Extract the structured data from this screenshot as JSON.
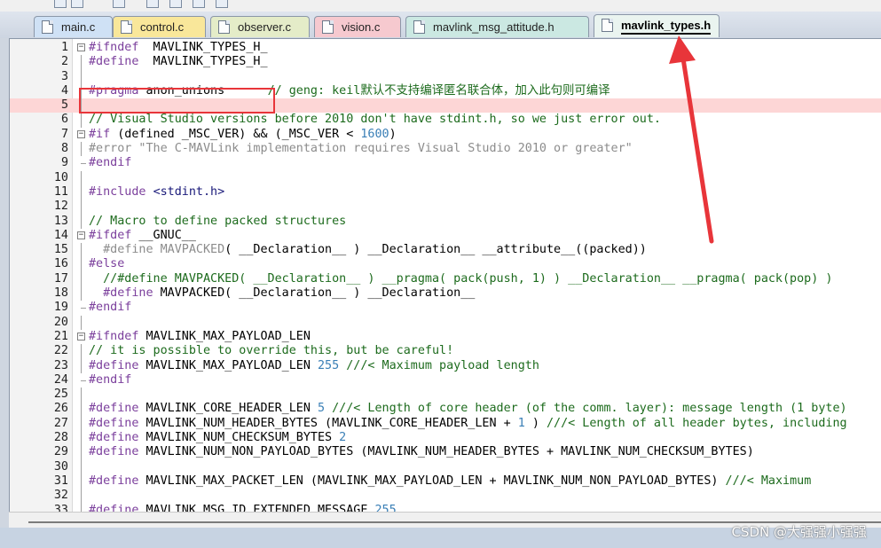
{
  "tabs": [
    {
      "label": "main.c",
      "bg": "#cfe1f5"
    },
    {
      "label": "control.c",
      "bg": "#f9e79a"
    },
    {
      "label": "observer.c",
      "bg": "#e4ecc8"
    },
    {
      "label": "vision.c",
      "bg": "#f6c9cf"
    },
    {
      "label": "mavlink_msg_attitude.h",
      "bg": "#cbe8e2"
    },
    {
      "label": "mavlink_types.h",
      "bg": "#eaf4f0",
      "active": true
    }
  ],
  "code_lines": [
    {
      "n": "1",
      "fold": "box",
      "t": [
        [
          "pp",
          "#ifndef"
        ],
        [
          "",
          "  MAVLINK_TYPES_H_"
        ]
      ]
    },
    {
      "n": "2",
      "fold": "bar",
      "t": [
        [
          "pp",
          "#define"
        ],
        [
          "",
          "  MAVLINK_TYPES_H_"
        ]
      ]
    },
    {
      "n": "3",
      "fold": "bar",
      "t": []
    },
    {
      "n": "4",
      "fold": "bar",
      "t": [
        [
          "pp",
          "#pragma"
        ],
        [
          "",
          " anon_unions"
        ],
        [
          "",
          "      "
        ],
        [
          "cm",
          "// geng: keil默认不支持编译匿名联合体，加入此句则可编译"
        ]
      ]
    },
    {
      "n": "5",
      "fold": "bar",
      "hl": true,
      "t": []
    },
    {
      "n": "6",
      "fold": "bar",
      "t": [
        [
          "cm",
          "// Visual Studio versions before 2010 don't have stdint.h, so we just error out."
        ]
      ]
    },
    {
      "n": "7",
      "fold": "box",
      "t": [
        [
          "pp",
          "#if"
        ],
        [
          "",
          " (defined _MSC_VER) && (_MSC_VER < "
        ],
        [
          "num",
          "1600"
        ],
        [
          "",
          ")"
        ]
      ]
    },
    {
      "n": "8",
      "fold": "bar",
      "t": [
        [
          "cmg",
          "#error \"The C-MAVLink implementation requires Visual Studio 2010 or greater\""
        ]
      ]
    },
    {
      "n": "9",
      "fold": "end",
      "t": [
        [
          "pp",
          "#endif"
        ]
      ]
    },
    {
      "n": "10",
      "fold": "bar",
      "t": []
    },
    {
      "n": "11",
      "fold": "bar",
      "t": [
        [
          "pp",
          "#include"
        ],
        [
          "",
          " "
        ],
        [
          "inc",
          "<stdint.h>"
        ]
      ]
    },
    {
      "n": "12",
      "fold": "bar",
      "t": []
    },
    {
      "n": "13",
      "fold": "bar",
      "t": [
        [
          "cm",
          "// Macro to define packed structures"
        ]
      ]
    },
    {
      "n": "14",
      "fold": "box",
      "t": [
        [
          "pp",
          "#ifdef"
        ],
        [
          "",
          " __GNUC__"
        ]
      ]
    },
    {
      "n": "15",
      "fold": "bar",
      "t": [
        [
          "cmg",
          "  #define MAVPACKED"
        ],
        [
          "",
          "( __Declaration__ ) __Declaration__ __attribute__((packed))"
        ]
      ]
    },
    {
      "n": "16",
      "fold": "bar",
      "t": [
        [
          "pp",
          "#else"
        ]
      ]
    },
    {
      "n": "17",
      "fold": "bar",
      "t": [
        [
          "cm",
          "  //#define MAVPACKED( __Declaration__ ) __pragma( pack(push, 1) ) __Declaration__ __pragma( pack(pop) )"
        ]
      ]
    },
    {
      "n": "18",
      "fold": "bar",
      "t": [
        [
          "pp",
          "  #define"
        ],
        [
          "",
          " MAVPACKED( __Declaration__ ) __Declaration__"
        ]
      ]
    },
    {
      "n": "19",
      "fold": "end",
      "t": [
        [
          "pp",
          "#endif"
        ]
      ]
    },
    {
      "n": "20",
      "fold": "bar",
      "t": []
    },
    {
      "n": "21",
      "fold": "box",
      "t": [
        [
          "pp",
          "#ifndef"
        ],
        [
          "",
          " MAVLINK_MAX_PAYLOAD_LEN"
        ]
      ]
    },
    {
      "n": "22",
      "fold": "bar",
      "t": [
        [
          "cm",
          "// it is possible to override this, but be careful!"
        ]
      ]
    },
    {
      "n": "23",
      "fold": "bar",
      "t": [
        [
          "pp",
          "#define"
        ],
        [
          "",
          " MAVLINK_MAX_PAYLOAD_LEN "
        ],
        [
          "num",
          "255"
        ],
        [
          "",
          " "
        ],
        [
          "cm",
          "///< Maximum payload length"
        ]
      ]
    },
    {
      "n": "24",
      "fold": "end",
      "t": [
        [
          "pp",
          "#endif"
        ]
      ]
    },
    {
      "n": "25",
      "fold": "bar",
      "t": []
    },
    {
      "n": "26",
      "fold": "bar",
      "t": [
        [
          "pp",
          "#define"
        ],
        [
          "",
          " MAVLINK_CORE_HEADER_LEN "
        ],
        [
          "num",
          "5"
        ],
        [
          "",
          " "
        ],
        [
          "cm",
          "///< Length of core header (of the comm. layer): message length (1 byte)"
        ]
      ]
    },
    {
      "n": "27",
      "fold": "bar",
      "t": [
        [
          "pp",
          "#define"
        ],
        [
          "",
          " MAVLINK_NUM_HEADER_BYTES (MAVLINK_CORE_HEADER_LEN + "
        ],
        [
          "num",
          "1"
        ],
        [
          "",
          " ) "
        ],
        [
          "cm",
          "///< Length of all header bytes, including"
        ]
      ]
    },
    {
      "n": "28",
      "fold": "bar",
      "t": [
        [
          "pp",
          "#define"
        ],
        [
          "",
          " MAVLINK_NUM_CHECKSUM_BYTES "
        ],
        [
          "num",
          "2"
        ]
      ]
    },
    {
      "n": "29",
      "fold": "bar",
      "t": [
        [
          "pp",
          "#define"
        ],
        [
          "",
          " MAVLINK_NUM_NON_PAYLOAD_BYTES (MAVLINK_NUM_HEADER_BYTES + MAVLINK_NUM_CHECKSUM_BYTES)"
        ]
      ]
    },
    {
      "n": "30",
      "fold": "bar",
      "t": []
    },
    {
      "n": "31",
      "fold": "bar",
      "t": [
        [
          "pp",
          "#define"
        ],
        [
          "",
          " MAVLINK_MAX_PACKET_LEN (MAVLINK_MAX_PAYLOAD_LEN + MAVLINK_NUM_NON_PAYLOAD_BYTES) "
        ],
        [
          "cm",
          "///< Maximum"
        ]
      ]
    },
    {
      "n": "32",
      "fold": "bar",
      "t": []
    },
    {
      "n": "33",
      "fold": "bar",
      "t": [
        [
          "pp",
          "#define"
        ],
        [
          "",
          " MAVLINK_MSG_ID_EXTENDED_MESSAGE "
        ],
        [
          "num",
          "255"
        ]
      ]
    }
  ],
  "watermark": "CSDN @大强强小强强",
  "annotation": {
    "color": "#e8353a"
  }
}
